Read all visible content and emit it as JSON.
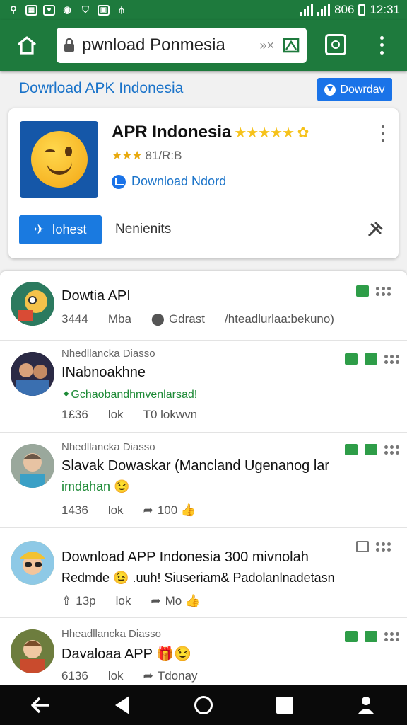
{
  "status": {
    "right_text": "806",
    "time": "12:31"
  },
  "browser": {
    "url": "pwnload Ponmesia",
    "url_extra": "»×"
  },
  "page": {
    "header_title": "Dowrload APK Indonesia",
    "download_button": "Dowrdav"
  },
  "app_card": {
    "title": "APR Indonesia",
    "title_stars": "★★★★★ ✿",
    "sub_stars": "★★★",
    "sub_text": "81/R:B",
    "download_link": "Download Ndord",
    "install_button": "Iohest",
    "secondary_label": "Nenienits"
  },
  "posts": [
    {
      "meta_top": "",
      "title": "Dowtia API",
      "line2": "",
      "foot": [
        "3444",
        "Mba",
        "Gdrast",
        "/hteadlurlaa:bekuno)"
      ]
    },
    {
      "meta_top": "Nhedllancka Diasso",
      "title": "INabnoakhne",
      "line2": "✦Gchaobandhmvenlarsad!",
      "foot": [
        "1£36",
        "lok",
        "T0 lokwvn"
      ]
    },
    {
      "meta_top": "Nhedllancka Diasso",
      "title": "Slavak Dowaskar (Mancland Ugenanog lar",
      "line2": "imdahan 😉",
      "foot": [
        "1436",
        "lok",
        "100 👍"
      ]
    },
    {
      "meta_top": "",
      "title": "Download APP Indonesia 300 mivnolah",
      "line2": "Redmde 😉 .uuh! Siuseriam& Padolanlnadetasn",
      "foot": [
        "13p",
        "lok",
        "Mo 👍"
      ]
    },
    {
      "meta_top": "Hheadllancka Diasso",
      "title": "Davaloaa APP 🎁😉",
      "line2": "",
      "foot": [
        "6136",
        "lok",
        "Tdonay"
      ]
    }
  ],
  "colors": {
    "toolbar": "#1e7a3d",
    "link_blue": "#1a73c9",
    "button_blue": "#1a73e8",
    "green_text": "#1d8a36"
  }
}
